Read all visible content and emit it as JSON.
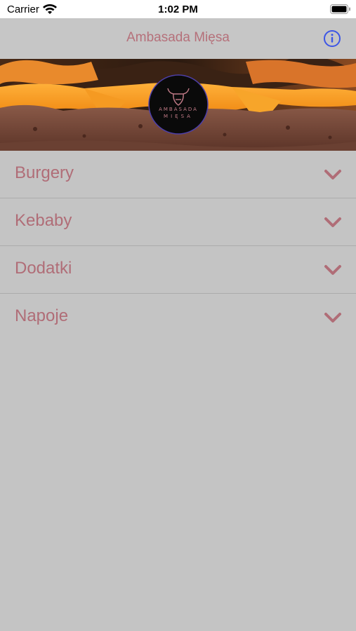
{
  "status_bar": {
    "carrier": "Carrier",
    "time": "1:02 PM",
    "wifi_icon": "wifi-icon",
    "battery_icon": "battery-icon"
  },
  "nav": {
    "title": "Ambasada Mięsa",
    "info_icon": "info-icon"
  },
  "hero": {
    "logo_line1": "AMBASADA",
    "logo_line2": "MIĘSA",
    "logo_icon": "bull-head-icon"
  },
  "menu": {
    "items": [
      {
        "label": "Burgery",
        "icon": "chevron-down-icon"
      },
      {
        "label": "Kebaby",
        "icon": "chevron-down-icon"
      },
      {
        "label": "Dodatki",
        "icon": "chevron-down-icon"
      },
      {
        "label": "Napoje",
        "icon": "chevron-down-icon"
      }
    ]
  },
  "colors": {
    "background": "#c4c4c4",
    "accent_text": "#b06d77",
    "info_blue": "#3c55e6"
  }
}
